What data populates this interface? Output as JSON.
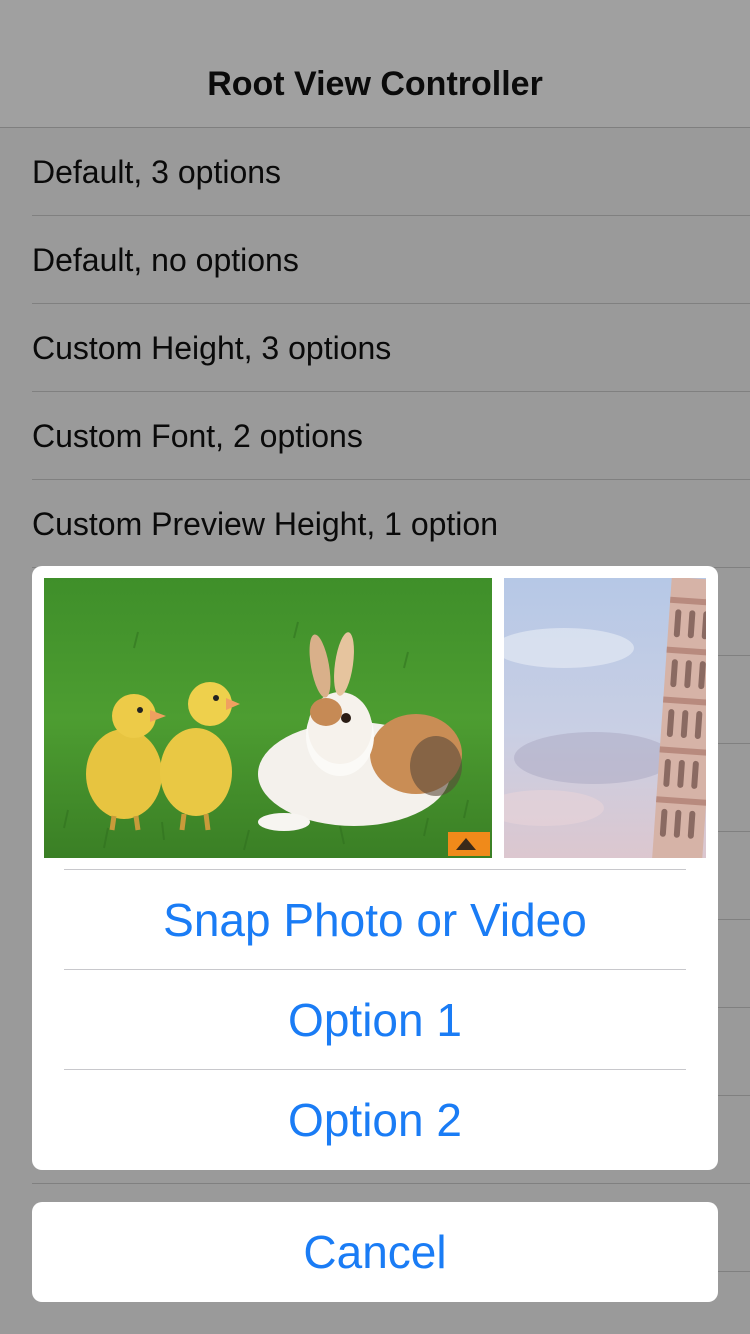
{
  "navbar": {
    "title": "Root View Controller"
  },
  "table": {
    "rows": [
      {
        "label": "Default, 3 options"
      },
      {
        "label": "Default, no options"
      },
      {
        "label": "Custom Height, 3 options"
      },
      {
        "label": "Custom Font, 2 options"
      },
      {
        "label": "Custom Preview Height, 1 option"
      },
      {
        "label": ""
      },
      {
        "label": ""
      },
      {
        "label": ""
      },
      {
        "label": ""
      },
      {
        "label": ""
      },
      {
        "label": ""
      },
      {
        "label": ""
      },
      {
        "label": ""
      }
    ]
  },
  "sheet": {
    "previews": [
      {
        "icon": "ducklings-and-rabbit-photo"
      },
      {
        "icon": "leaning-tower-photo"
      }
    ],
    "actions": [
      {
        "label": "Snap Photo or Video"
      },
      {
        "label": "Option 1"
      },
      {
        "label": "Option 2"
      }
    ],
    "cancel_label": "Cancel"
  },
  "colors": {
    "accent": "#1a7cf5",
    "dim_background": "#9a9a9a"
  }
}
